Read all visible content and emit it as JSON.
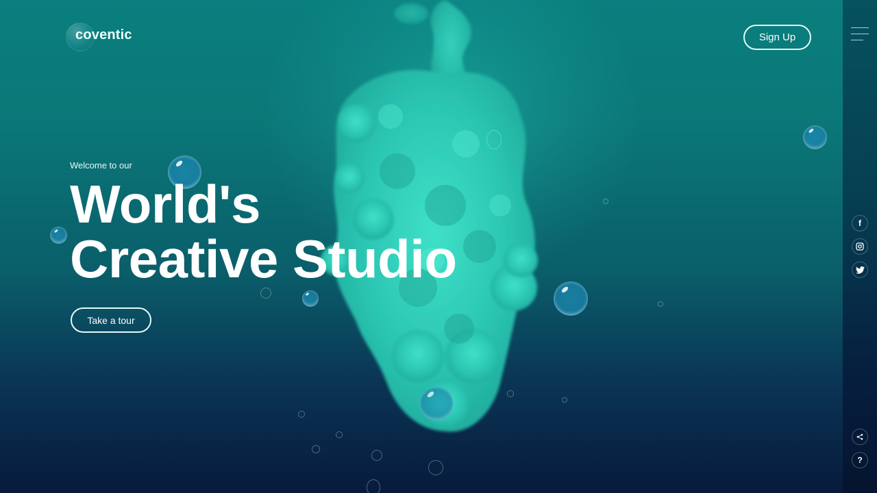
{
  "brand": {
    "name": "coventic"
  },
  "header": {
    "signup_label": "Sign Up",
    "menu_icon": "hamburger-menu-icon"
  },
  "hero": {
    "eyebrow": "Welcome to our",
    "title_line1": "World's",
    "title_line2": "Creative Studio",
    "cta_label": "Take a tour"
  },
  "rail": {
    "social": [
      {
        "name": "facebook",
        "icon": "facebook-icon",
        "glyph": "f"
      },
      {
        "name": "instagram",
        "icon": "instagram-icon",
        "glyph": "◎"
      },
      {
        "name": "twitter",
        "icon": "twitter-icon",
        "glyph": "🐦"
      }
    ],
    "utility": [
      {
        "name": "share",
        "icon": "share-icon",
        "glyph": "<"
      },
      {
        "name": "help",
        "icon": "help-icon",
        "glyph": "?"
      }
    ]
  },
  "colors": {
    "top": "#0a7f7e",
    "bottom": "#081a3c",
    "ink": "#2fd1be",
    "rail": "#063f52"
  }
}
